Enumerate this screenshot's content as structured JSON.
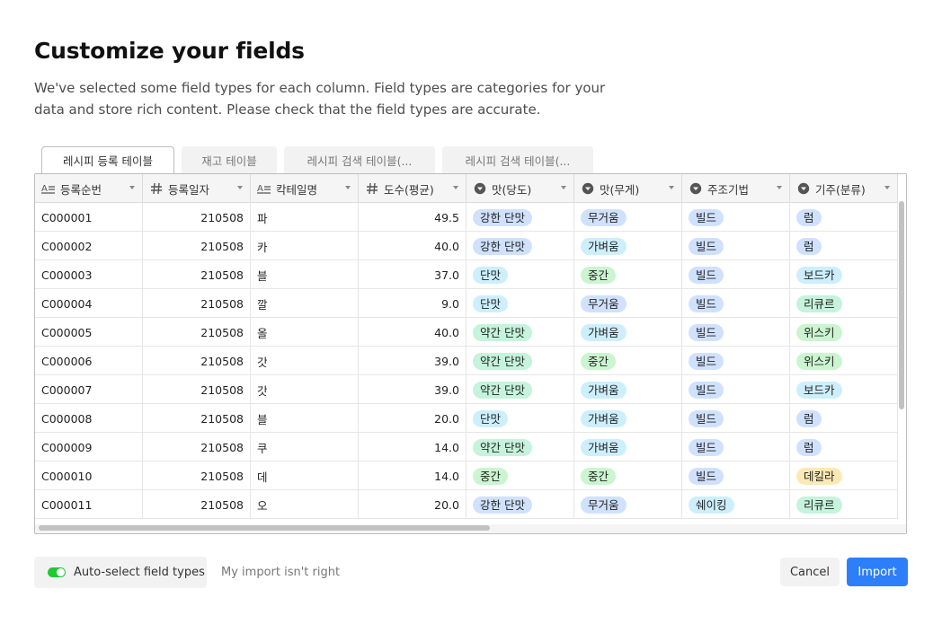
{
  "title": "Customize your fields",
  "subtitle": "We've selected some field types for each column. Field types are categories for your data and store rich content. Please check that the field types are accurate.",
  "tabs": [
    {
      "label": "레시피 등록 테이블",
      "active": true
    },
    {
      "label": "재고 테이블",
      "active": false
    },
    {
      "label": "레시피 검색 테이블(...",
      "active": false
    },
    {
      "label": "레시피 검색 테이블(...",
      "active": false
    }
  ],
  "columns": [
    {
      "name": "등록순번",
      "type_icon": "text-icon"
    },
    {
      "name": "등록일자",
      "type_icon": "number-icon"
    },
    {
      "name": "칵테일명",
      "type_icon": "text-icon"
    },
    {
      "name": "도수(평균)",
      "type_icon": "number-icon"
    },
    {
      "name": "맛(당도)",
      "type_icon": "single-select-icon"
    },
    {
      "name": "맛(무게)",
      "type_icon": "single-select-icon"
    },
    {
      "name": "주조기법",
      "type_icon": "single-select-icon"
    },
    {
      "name": "기주(분류)",
      "type_icon": "single-select-icon"
    }
  ],
  "rows": [
    [
      "C000001",
      "210508",
      "파",
      "49.5",
      "강한 단맛",
      "무거움",
      "빌드",
      "럼"
    ],
    [
      "C000002",
      "210508",
      "카",
      "40.0",
      "강한 단맛",
      "가벼움",
      "빌드",
      "럼"
    ],
    [
      "C000003",
      "210508",
      "블",
      "37.0",
      "단맛",
      "중간",
      "빌드",
      "보드카"
    ],
    [
      "C000004",
      "210508",
      "깔",
      "9.0",
      "단맛",
      "무거움",
      "빌드",
      "리큐르"
    ],
    [
      "C000005",
      "210508",
      "올",
      "40.0",
      "약간 단맛",
      "가벼움",
      "빌드",
      "위스키"
    ],
    [
      "C000006",
      "210508",
      "갓",
      "39.0",
      "약간 단맛",
      "중간",
      "빌드",
      "위스키"
    ],
    [
      "C000007",
      "210508",
      "갓",
      "39.0",
      "약간 단맛",
      "가벼움",
      "빌드",
      "보드카"
    ],
    [
      "C000008",
      "210508",
      "블",
      "20.0",
      "단맛",
      "가벼움",
      "빌드",
      "럼"
    ],
    [
      "C000009",
      "210508",
      "쿠",
      "14.0",
      "약간 단맛",
      "가벼움",
      "빌드",
      "럼"
    ],
    [
      "C000010",
      "210508",
      "데",
      "14.0",
      "중간",
      "중간",
      "빌드",
      "데킬라"
    ],
    [
      "C000011",
      "210508",
      "오",
      "20.0",
      "강한 단맛",
      "무거움",
      "쉐이킹",
      "리큐르"
    ]
  ],
  "pill_colors": {
    "강한 단맛": "#d0e1fd",
    "단맛": "#cdeffd",
    "약간 단맛": "#c5f3dc",
    "중간": "#cbf5d0",
    "무거움": "#d0e1fd",
    "가벼움": "#cdeffd",
    "빌드": "#d0e1fd",
    "쉐이킹": "#cdeffd",
    "럼": "#d0e1fd",
    "보드카": "#cdeffd",
    "리큐르": "#c5f3dc",
    "위스키": "#cbf5d0",
    "데킬라": "#fde9b6"
  },
  "footer": {
    "auto_select_label": "Auto-select field types",
    "auto_select_on": true,
    "wrong_link": "My import isn't right",
    "cancel_label": "Cancel",
    "import_label": "Import"
  },
  "accent_color": "#2d7ff9",
  "toggle_color": "#20c933"
}
